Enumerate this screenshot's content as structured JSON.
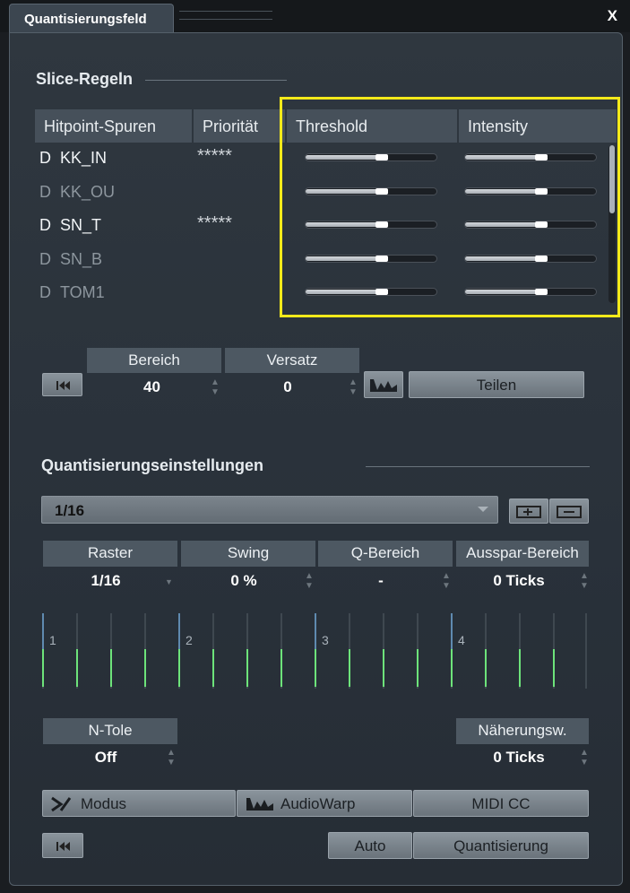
{
  "window": {
    "tab_title": "Quantisierungsfeld",
    "close_label": "X"
  },
  "slice_rules": {
    "title": "Slice-Regeln",
    "columns": [
      "Hitpoint-Spuren",
      "Priorität",
      "Threshold",
      "Intensity"
    ],
    "rows": [
      {
        "prefix": "D",
        "name": "KK_IN",
        "priority": "*****",
        "active": true,
        "threshold": 0.58,
        "intensity": 0.58
      },
      {
        "prefix": "D",
        "name": "KK_OU",
        "priority": "",
        "active": false,
        "threshold": 0.58,
        "intensity": 0.58
      },
      {
        "prefix": "D",
        "name": "SN_T",
        "priority": "*****",
        "active": true,
        "threshold": 0.58,
        "intensity": 0.58
      },
      {
        "prefix": "D",
        "name": "SN_B",
        "priority": "",
        "active": false,
        "threshold": 0.58,
        "intensity": 0.58
      },
      {
        "prefix": "D",
        "name": "TOM1",
        "priority": "",
        "active": false,
        "threshold": 0.58,
        "intensity": 0.58
      }
    ],
    "bereich_label": "Bereich",
    "bereich_value": "40",
    "versatz_label": "Versatz",
    "versatz_value": "0",
    "teilen_label": "Teilen"
  },
  "quant_settings": {
    "title": "Quantisierungseinstellungen",
    "preset": "1/16",
    "raster_label": "Raster",
    "raster_value": "1/16",
    "swing_label": "Swing",
    "swing_value": "0 %",
    "qbereich_label": "Q-Bereich",
    "qbereich_value": "-",
    "aussparbereich_label": "Ausspar-Bereich",
    "aussparbereich_value": "0 Ticks",
    "beats": [
      "1",
      "2",
      "3",
      "4"
    ],
    "ntole_label": "N-Tole",
    "ntole_value": "Off",
    "naeherung_label": "Näherungsw.",
    "naeherung_value": "0 Ticks",
    "modus_label": "Modus",
    "audiowarp_label": "AudioWarp",
    "midicc_label": "MIDI CC",
    "auto_label": "Auto",
    "quantisierung_label": "Quantisierung"
  },
  "colors": {
    "highlight": "#f5ea1a",
    "grid_green": "#6de37a",
    "panel": "#2f373f"
  }
}
